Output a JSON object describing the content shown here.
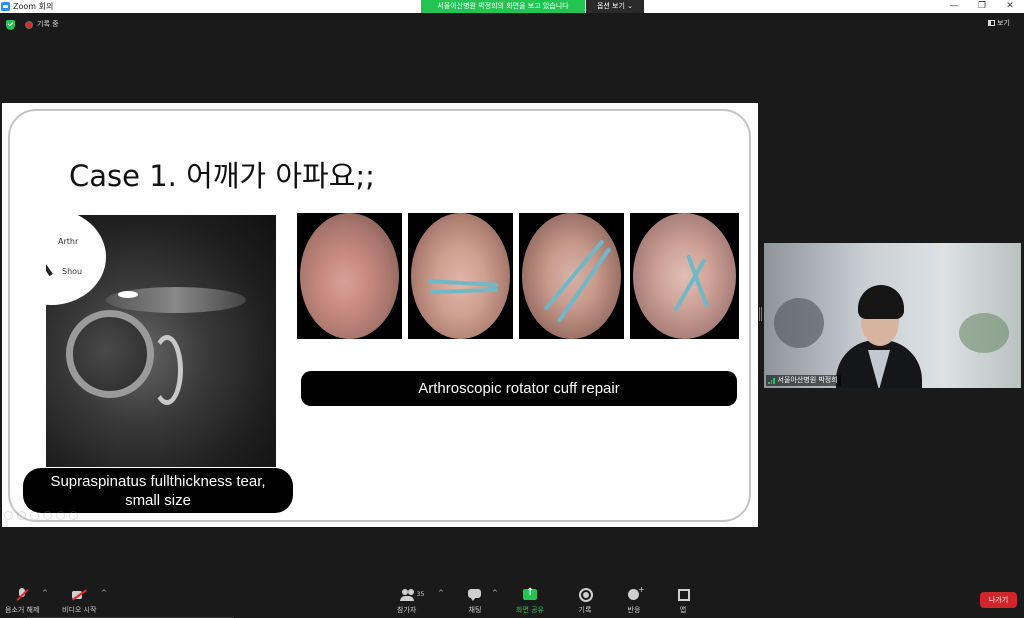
{
  "window": {
    "title": "Zoom 회의",
    "share_banner": "서울아산병원 박정희의 화면을 보고 있습니다",
    "view_options": "옵션 보기 ⌄",
    "controls": {
      "minimize": "—",
      "maximize": "❐",
      "close": "✕"
    }
  },
  "status": {
    "recording_label": "기록 중",
    "view_label": "보기"
  },
  "slide": {
    "title": "Case 1. 어깨가 아파요;;",
    "mri_label_1": "Arthr",
    "mri_label_2": "Shou",
    "repair_caption": "Arthroscopic rotator cuff repair",
    "tear_caption_line1": "Supraspinatus fullthickness tear,",
    "tear_caption_line2": "small size"
  },
  "participant": {
    "name": "서울아산병원 박정희"
  },
  "toolbar": {
    "mute_label": "음소거 해제",
    "video_label": "비디오 시작",
    "participants_label": "참가자",
    "participants_count": "35",
    "chat_label": "채팅",
    "share_label": "화면 공유",
    "record_label": "기록",
    "reaction_label": "반응",
    "apps_label": "앱",
    "leave_label": "나가기",
    "caret": "^"
  },
  "colors": {
    "accent_green": "#23c552",
    "leave_red": "#d0252b",
    "zoom_blue": "#2d8cff"
  }
}
